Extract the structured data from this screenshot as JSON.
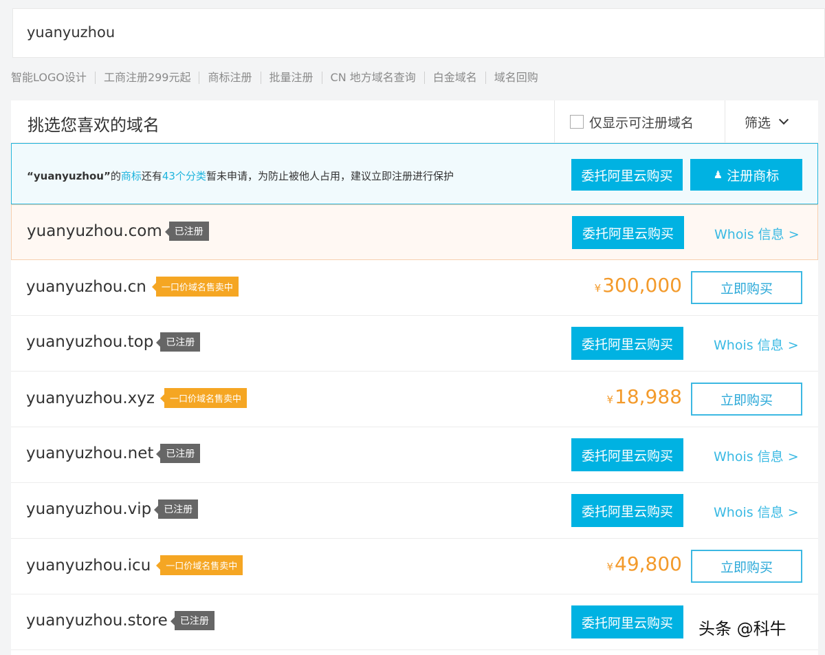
{
  "search": {
    "value": "yuanyuzhou"
  },
  "quick_links": [
    "智能LOGO设计",
    "工商注册299元起",
    "商标注册",
    "批量注册",
    "CN 地方域名查询",
    "白金域名",
    "域名回购"
  ],
  "panel": {
    "title": "挑选您喜欢的域名",
    "only_available": "仅显示可注册域名",
    "filter": "筛选"
  },
  "notice": {
    "prefix": "“yuanyuzhou”",
    "part1": "的",
    "link1": "商标",
    "part2": "还有",
    "link2": "43个分类",
    "part3": "暂未申请，为防止被他人占用，建议立即注册进行保护",
    "buy_label": "委托阿里云购买",
    "trademark_label": "注册商标"
  },
  "labels": {
    "registered": "已注册",
    "for_sale": "一口价域名售卖中",
    "delegate_buy": "委托阿里云购买",
    "whois": "Whois 信息 >",
    "buy_now": "立即购买",
    "currency": "¥"
  },
  "rows": [
    {
      "domain": "yuanyuzhou.com",
      "status": "registered"
    },
    {
      "domain": "yuanyuzhou.cn",
      "status": "sale",
      "price": "300,000"
    },
    {
      "domain": "yuanyuzhou.top",
      "status": "registered"
    },
    {
      "domain": "yuanyuzhou.xyz",
      "status": "sale",
      "price": "18,988"
    },
    {
      "domain": "yuanyuzhou.net",
      "status": "registered"
    },
    {
      "domain": "yuanyuzhou.vip",
      "status": "registered"
    },
    {
      "domain": "yuanyuzhou.icu",
      "status": "sale",
      "price": "49,800"
    },
    {
      "domain": "yuanyuzhou.store",
      "status": "registered"
    }
  ],
  "watermark": "头条 @科牛",
  "colors": {
    "accent": "#00b2e2",
    "price": "#f39a2b",
    "sale_tag": "#f5a623",
    "registered_tag": "#666666"
  }
}
